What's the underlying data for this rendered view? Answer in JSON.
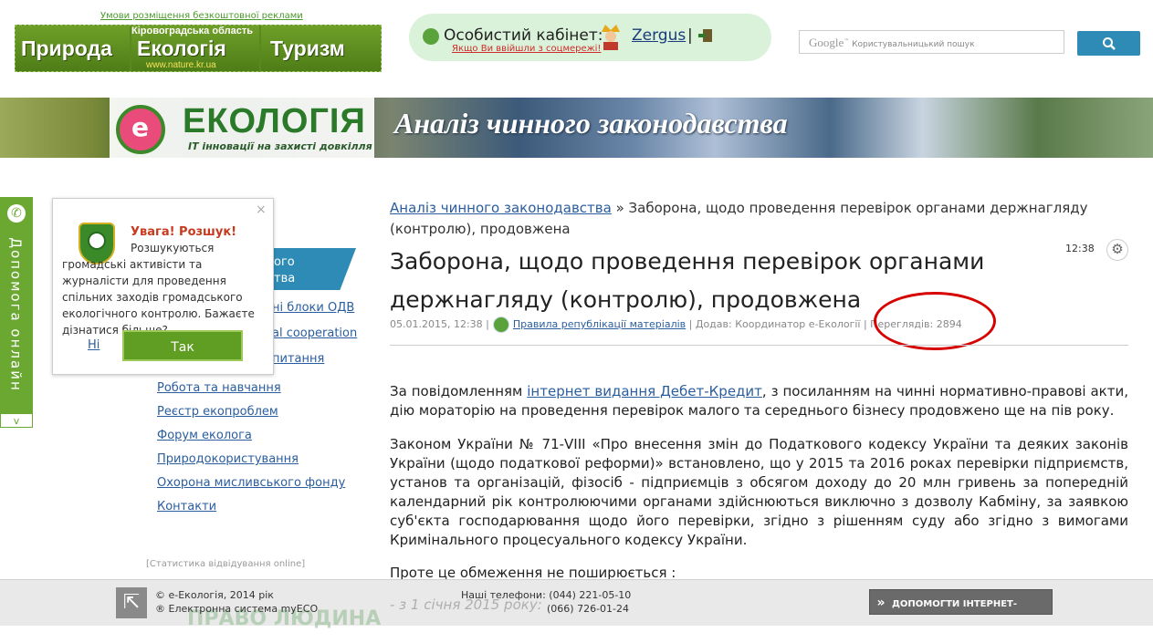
{
  "top": {
    "ad_link": "Умови розміщення безкоштовної реклами",
    "banner": {
      "seg1": "Природа",
      "seg2": "Екологія",
      "seg3": "Туризм",
      "region": "Кіровоградська область",
      "url": "www.nature.kr.ua"
    }
  },
  "cabinet": {
    "label": "Особистий кабінет:",
    "user": "Zergus",
    "separator": "|",
    "social_note": "Якщо Ви ввійшли з соцмережі!"
  },
  "search": {
    "brand": "Google",
    "placeholder": "Користувальницький пошук"
  },
  "hero": {
    "logo_letter": "е",
    "title": "ЕКОЛОГІЯ",
    "subtitle": "IT інновації на захисті довкілля",
    "section": "Аналіз чинного законодавства"
  },
  "help_tab": {
    "label": "Допомога онлайн",
    "arrow": "v"
  },
  "popup": {
    "close": "×",
    "title": "Увага! Розшук!",
    "text": "Розшукуються громадські активісти та журналісти для проведення спільних заходів громадського екологічного контролю. Бажаєте дізнатися більше?",
    "no": "Ні",
    "yes": "Так"
  },
  "menu": {
    "active_partial": "...ого\n...тва",
    "partial_items": [
      "...ні блоки ОДВ",
      "...al cooperation",
      "...питання"
    ],
    "items": [
      "Робота та навчання",
      "Реєстр екопроблем",
      "Форум еколога",
      "Природокористування",
      "Охорона мисливського фонду",
      "Контакти"
    ],
    "stats": "[Статистика відвідування online]"
  },
  "article": {
    "breadcrumb_link": "Аналіз чинного законодавства",
    "breadcrumb_rest": " » Заборона, щодо проведення перевірок органами держнагляду (контролю), продовжена",
    "time": "12:38",
    "title": "Заборона, щодо проведення перевірок органами держнагляду (контролю), продовжена",
    "meta": {
      "date": "05.01.2015, 12:38 |",
      "rules_link": "Правила републікації матеріалів",
      "added": " | Додав: Координатор е-Екології |",
      "views": " Переглядів: 2894"
    },
    "p1_before": "За повідомленням ",
    "p1_link": "інтернет видання Дебет-Кредит",
    "p1_after": ", з посиланням на чинні нормативно-правові акти, дію мораторію на проведення перевірок малого та середнього бізнесу продовжено ще на пів року.",
    "p2": "Законом України № 71-VIII «Про внесення змін до Податкового кодексу України та деяких законів України (щодо податкової реформи)» встановлено, що у 2015 та 2016 роках перевірки підприємств, установ та організацій, фізосіб - підприємців з обсягом доходу до 20 млн гривень за попередній календарний рік контролюючими органами здійснюються виключно з дозволу Кабміну, за заявкою суб'єкта господарювання щодо його перевірки, згідно з рішенням суду або згідно з вимогами Кримінального процесуального кодексу України.",
    "p3": "Проте це обмеження не поширюється :",
    "p4": "- з 1 січня 2015 року:"
  },
  "footer": {
    "copy1": "© е-Екологія, 2014 рік",
    "copy2": "® Електронна система myECO",
    "phones_label": "Наші телефони:",
    "phone1": "(044) 221-05-10",
    "phone2": "(066) 726-01-24",
    "help_btn": "ДОПОМОГТИ ІНТЕРНЕТ-ПРОЕКТУ",
    "watermark": "ПРАВО ЛЮДИНА"
  }
}
